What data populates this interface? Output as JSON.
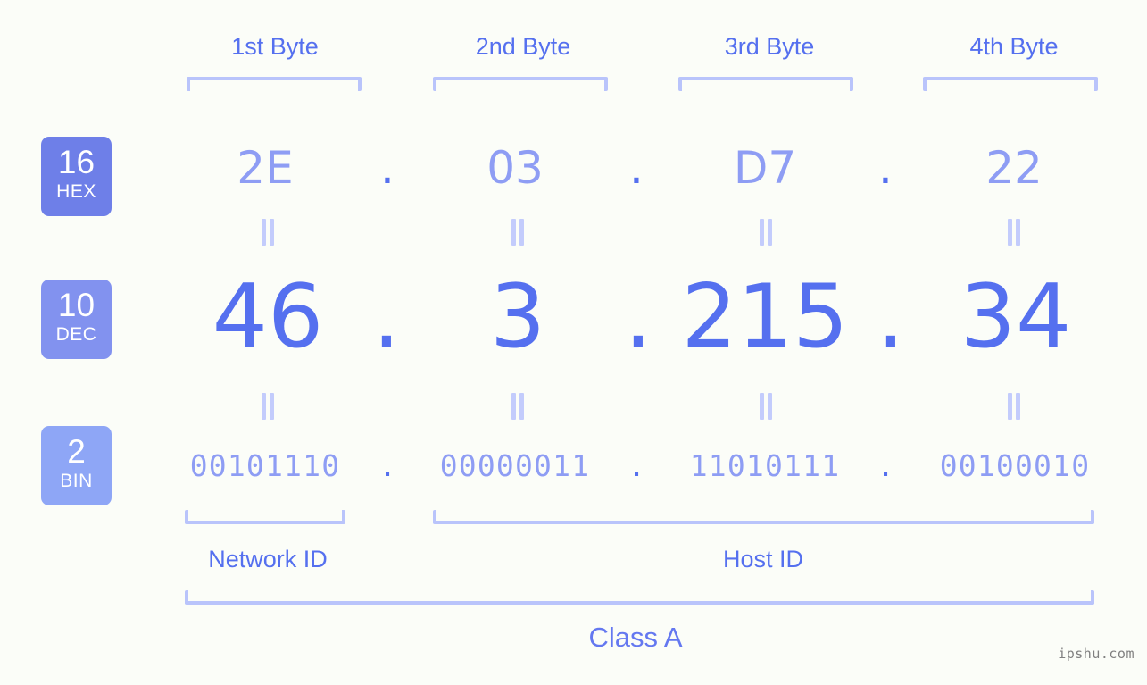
{
  "background": "#fbfdf8",
  "accent": "#5570ef",
  "accent_light": "#8e9df4",
  "bracket_color": "#b9c4fb",
  "header": {
    "bytes": [
      {
        "label": "1st Byte"
      },
      {
        "label": "2nd Byte"
      },
      {
        "label": "3rd Byte"
      },
      {
        "label": "4th Byte"
      }
    ]
  },
  "bases": [
    {
      "num": "16",
      "word": "HEX",
      "color": "#6e7fe8"
    },
    {
      "num": "10",
      "word": "DEC",
      "color": "#8292ef"
    },
    {
      "num": "2",
      "word": "BIN",
      "color": "#8ea6f6"
    }
  ],
  "separator": {
    "symbol": ".",
    "equals": "="
  },
  "rows": {
    "hex": {
      "values": [
        "2E",
        "03",
        "D7",
        "22"
      ],
      "dots": [
        ".",
        ".",
        "."
      ]
    },
    "dec": {
      "values": [
        "46",
        "3",
        "215",
        "34"
      ],
      "dots": [
        ".",
        ".",
        "."
      ]
    },
    "bin": {
      "values": [
        "00101110",
        "00000011",
        "11010111",
        "00100010"
      ],
      "dots": [
        ".",
        ".",
        "."
      ]
    }
  },
  "footer": {
    "network_id_label": "Network ID",
    "host_id_label": "Host ID",
    "class_label": "Class A",
    "watermark": "ipshu.com"
  },
  "chart_data": {
    "type": "table",
    "title": "IP address 46.3.215.34 byte breakdown",
    "categories": [
      "1st Byte",
      "2nd Byte",
      "3rd Byte",
      "4th Byte"
    ],
    "series": [
      {
        "name": "HEX",
        "values": [
          "2E",
          "03",
          "D7",
          "22"
        ]
      },
      {
        "name": "DEC",
        "values": [
          "46",
          "3",
          "215",
          "34"
        ]
      },
      {
        "name": "BIN",
        "values": [
          "00101110",
          "00000011",
          "11010111",
          "00100010"
        ]
      }
    ],
    "annotations": [
      "Network ID",
      "Host ID",
      "Class A"
    ]
  }
}
